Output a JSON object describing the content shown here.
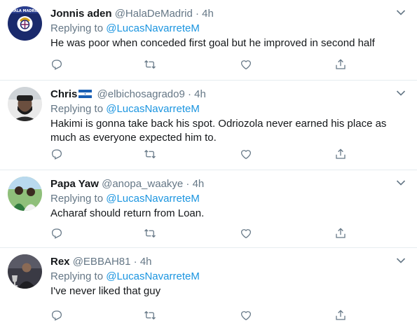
{
  "replying_to_label": "Replying to",
  "colors": {
    "accent": "#1b95e0",
    "muted": "#657786",
    "text": "#14171a",
    "divider": "#e6ecf0"
  },
  "tweets": [
    {
      "name": "Jonnis aden",
      "handle": "@HalaDeMadrid",
      "separator": "·",
      "time": "4h",
      "replying_to": "@LucasNavarreteM",
      "text": "He was poor when conceded first goal but he improved in second half",
      "avatar": "real-madrid-crest-avatar",
      "avatar_text": "HALA MADRID"
    },
    {
      "name": "Chris",
      "name_flag": "honduras-flag",
      "handle": "@elbichosagrado9",
      "separator": "·",
      "time": "4h",
      "replying_to": "@LucasNavarreteM",
      "text": "Hakimi is gonna take back his spot. Odriozola never earned his place as much as everyone expected him to.",
      "avatar": "bearded-man-avatar"
    },
    {
      "name": "Papa Yaw",
      "handle": "@anopa_waakye",
      "separator": "·",
      "time": "4h",
      "replying_to": "@LucasNavarreteM",
      "text": "Acharaf should return from Loan.",
      "avatar": "two-men-outdoor-avatar"
    },
    {
      "name": "Rex",
      "handle": "@EBBAH81",
      "separator": "·",
      "time": "4h",
      "replying_to": "@LucasNavarreteM",
      "text": "I've never liked that guy",
      "avatar": "man-with-trophy-avatar"
    }
  ]
}
